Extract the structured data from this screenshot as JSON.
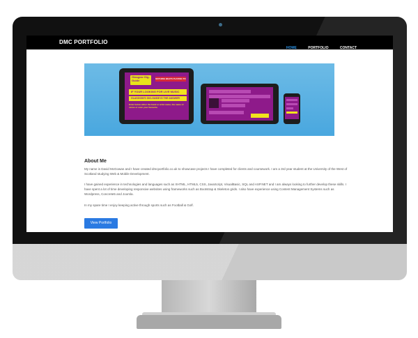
{
  "site": {
    "brand": "DMC PORTFOLIO",
    "nav": [
      {
        "label": "HOME",
        "active": true
      },
      {
        "label": "PORTFOLIO",
        "active": false
      },
      {
        "label": "CONTACT",
        "active": false
      }
    ]
  },
  "hero": {
    "app_logo": "Glasgow Gig-Guide",
    "app_tagline_1": "IF YOUR LOOKING FOR LIVE MUSIC",
    "app_tagline_2": "GLASGOW'S GIG-GUIDE IS THE ANSWER",
    "app_note": "Enter below either the band or artist name, the name of venue or even your favourite",
    "app_badge": "NOTHING BEATS PLAYING TO"
  },
  "about": {
    "title": "About Me",
    "p1": "My name is David McGowan and I have created dmcportfolio.co.uk to showcase projects I have completed for clients and coursework. I am a 3rd year student at the University of the West of Scotland studying Web & Mobile Development.",
    "p2": "I have gained experience in technologies and languages such as XHTML, HTML5, CSS, JavaScript, VisualBasic, SQL and ASP.NET and I am always looking to further develop these skills. I have spent a lot of time developing responsive websites using frameworks such as Bootstrap & Skeleton grids. I also have experience using Content Management Systems such as Wordpress, Concrete5 and Joomla.",
    "p3": "In my spare time I enjoy keeping active through sports such as Football & Golf.",
    "button": "View Portfolio"
  },
  "colors": {
    "accent": "#2a7ae2",
    "nav_bg": "#000000",
    "hero_bg": "#49a7df",
    "app_purple": "#8e1a8a",
    "app_yellow": "#f2e31d"
  }
}
